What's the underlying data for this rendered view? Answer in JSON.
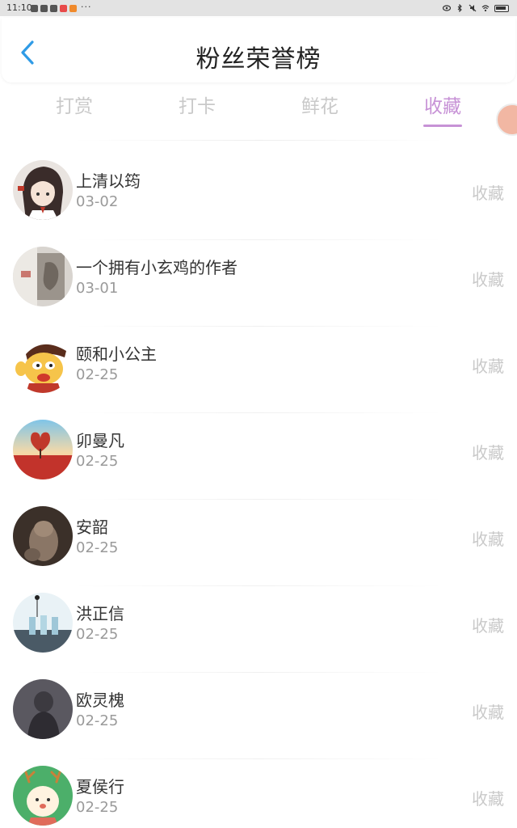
{
  "status_bar": {
    "time": "11:10",
    "dots": "···"
  },
  "header": {
    "title": "粉丝荣誉榜"
  },
  "tabs": [
    {
      "label": "打赏",
      "active": false
    },
    {
      "label": "打卡",
      "active": false
    },
    {
      "label": "鲜花",
      "active": false
    },
    {
      "label": "收藏",
      "active": true
    }
  ],
  "fans": [
    {
      "name": "上清以筠",
      "date": "03-02",
      "action": "收藏"
    },
    {
      "name": "一个拥有小玄鸡的作者",
      "date": "03-01",
      "action": "收藏"
    },
    {
      "name": "颐和小公主",
      "date": "02-25",
      "action": "收藏"
    },
    {
      "name": "卯曼凡",
      "date": "02-25",
      "action": "收藏"
    },
    {
      "name": "安韶",
      "date": "02-25",
      "action": "收藏"
    },
    {
      "name": "洪正信",
      "date": "02-25",
      "action": "收藏"
    },
    {
      "name": "欧灵槐",
      "date": "02-25",
      "action": "收藏"
    },
    {
      "name": "夏侯行",
      "date": "02-25",
      "action": "收藏"
    }
  ],
  "colors": {
    "accent": "#c792d6",
    "back_arrow": "#2f9be6",
    "muted": "#c9c9c9"
  }
}
